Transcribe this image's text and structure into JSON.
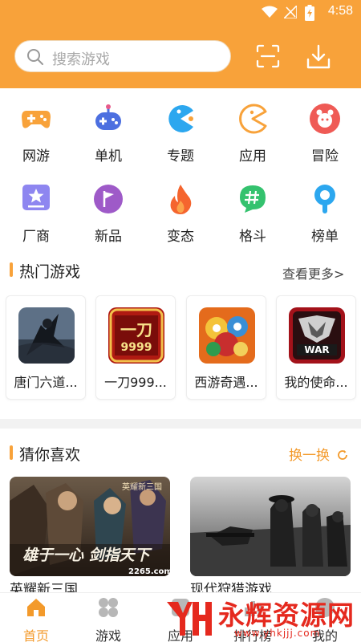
{
  "status_bar": {
    "time": "4:58"
  },
  "search": {
    "placeholder": "搜索游戏"
  },
  "categories": [
    {
      "label": "网游",
      "icon": "gamepad-icon"
    },
    {
      "label": "单机",
      "icon": "controller-icon"
    },
    {
      "label": "专题",
      "icon": "pacman-icon"
    },
    {
      "label": "应用",
      "icon": "pacman-outline-icon"
    },
    {
      "label": "冒险",
      "icon": "character-icon"
    },
    {
      "label": "厂商",
      "icon": "star-badge-icon"
    },
    {
      "label": "新品",
      "icon": "flag-icon"
    },
    {
      "label": "变态",
      "icon": "flame-icon"
    },
    {
      "label": "格斗",
      "icon": "hashtag-icon"
    },
    {
      "label": "榜单",
      "icon": "ranking-icon"
    }
  ],
  "hot_section": {
    "title": "热门游戏",
    "more": "查看更多>"
  },
  "hot_games": [
    {
      "name": "唐门六道..."
    },
    {
      "name": "一刀999..."
    },
    {
      "name": "西游奇遇..."
    },
    {
      "name": "我的使命..."
    }
  ],
  "hot_thumb_text": {
    "g2": "一刀",
    "g2_sub": "9999",
    "g4": "WAR"
  },
  "guess_section": {
    "title": "猜你喜欢",
    "swap": "换一换"
  },
  "guess_games": [
    {
      "name": "英耀新三国",
      "art_text": "雄于一心 剑指天下",
      "art_badge": "2265.com",
      "art_logo": "英耀新三国"
    },
    {
      "name": "现代狩猎游戏"
    }
  ],
  "bottom_nav": [
    {
      "label": "首页",
      "active": true
    },
    {
      "label": "游戏",
      "active": false
    },
    {
      "label": "应用",
      "active": false
    },
    {
      "label": "排行榜",
      "active": false
    },
    {
      "label": "我的",
      "active": false
    }
  ],
  "watermark": {
    "title": "永辉资源网",
    "url": "www.yhkjjj.com"
  },
  "colors": {
    "accent": "#f8a23a",
    "accent_text": "#f39a2b",
    "watermark_red": "#e5291e"
  }
}
